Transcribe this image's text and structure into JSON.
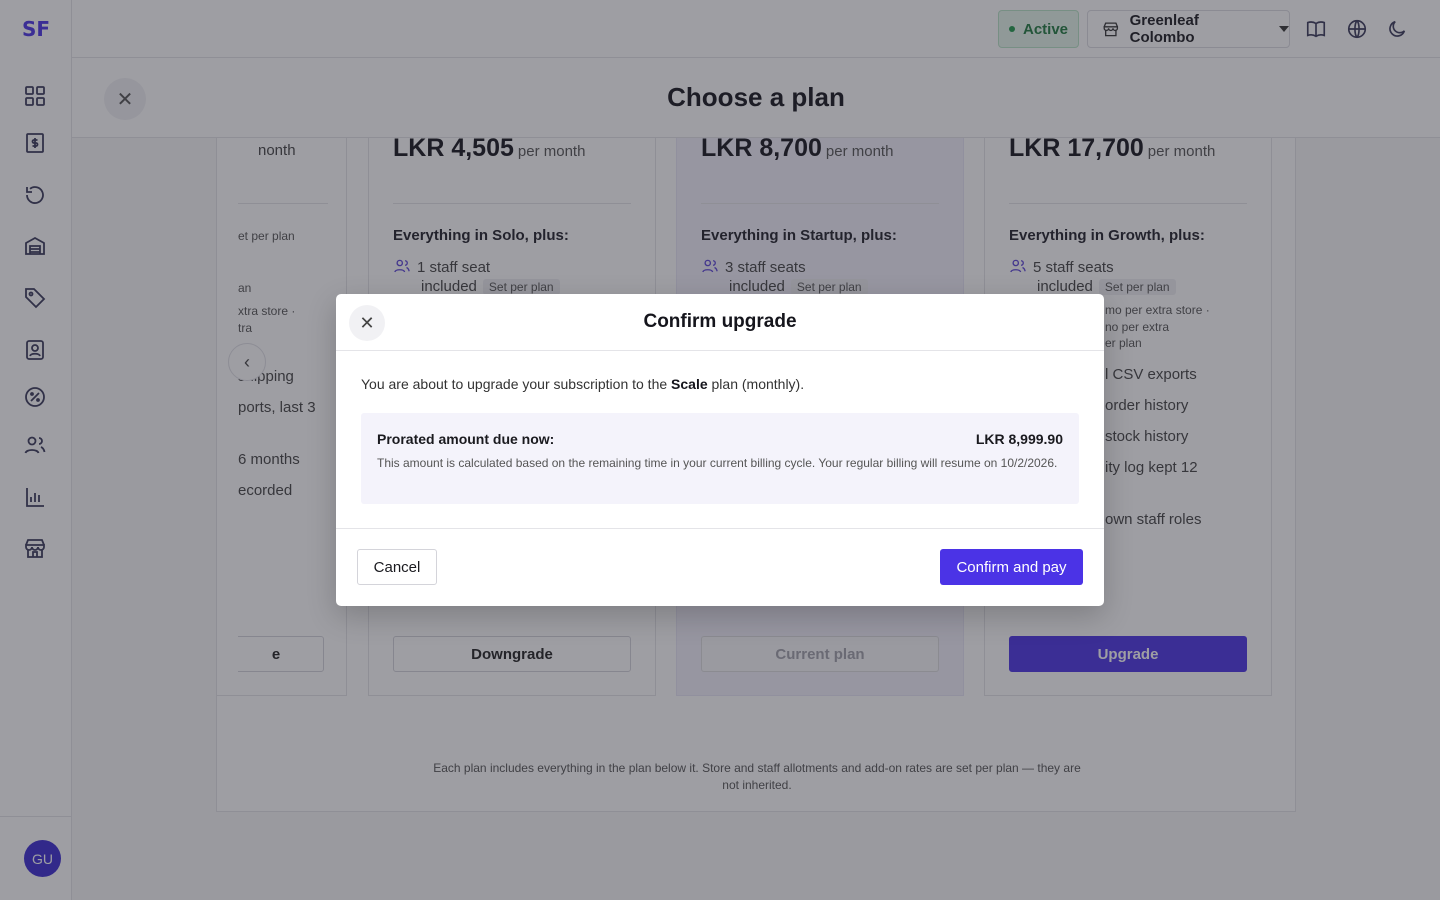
{
  "app": {
    "logo_text": "SF",
    "user_initials": "GU"
  },
  "topbar": {
    "status_label": "Active",
    "store_name": "Greenleaf Colombo"
  },
  "sheet": {
    "title": "Choose a plan"
  },
  "plans": [
    {
      "id": "solo",
      "partial_price_unit": "nonth",
      "partial_features": [
        "et per plan",
        "an",
        "xtra store ·",
        "tra",
        "shipping",
        "ports, last 3",
        "6 months",
        "ecorded"
      ],
      "button_label": "e"
    },
    {
      "id": "startup",
      "price": "LKR 4,505",
      "unit": "per month",
      "everything": "Everything in Solo, plus:",
      "seat_text": "1 staff seat",
      "seat_included": "included",
      "seat_tag": "Set per plan",
      "button_label": "Downgrade"
    },
    {
      "id": "growth",
      "price": "LKR 8,700",
      "unit": "per month",
      "everything": "Everything in Startup, plus:",
      "seat_text": "3 staff seats",
      "seat_included": "included",
      "seat_tag": "Set per plan",
      "button_label": "Current plan"
    },
    {
      "id": "scale",
      "price": "LKR 17,700",
      "unit": "per month",
      "everything": "Everything in Growth, plus:",
      "seat_text": "5 staff seats",
      "seat_included": "included",
      "seat_tag": "Set per plan",
      "partial_features": [
        "mo per extra store ·",
        "no per extra",
        "er plan",
        "l CSV exports",
        "order history",
        "stock history",
        "ity log kept 12",
        "own staff roles"
      ],
      "button_label": "Upgrade"
    }
  ],
  "footnote": "Each plan includes everything in the plan below it. Store and staff allotments and add-on rates are set per plan — they are not inherited.",
  "modal": {
    "title": "Confirm upgrade",
    "message_prefix": "You are about to upgrade your subscription to the",
    "plan_name": "Scale",
    "message_suffix": "plan (monthly).",
    "prorate_label": "Prorated amount due now:",
    "prorate_amount": "LKR 8,999.90",
    "prorate_note": "This amount is calculated based on the remaining time in your current billing cycle. Your regular billing will resume on 10/2/2026.",
    "cancel_label": "Cancel",
    "confirm_label": "Confirm and pay"
  },
  "colors": {
    "accent": "#4b33e6",
    "active_green": "#1f7a3f"
  }
}
